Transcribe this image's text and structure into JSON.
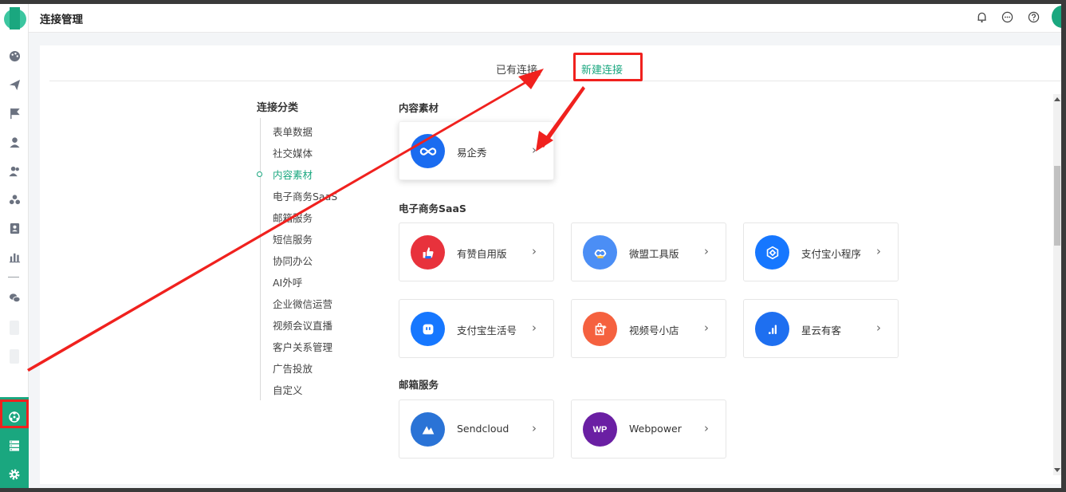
{
  "header": {
    "title": "连接管理"
  },
  "tabs": [
    {
      "label": "已有连接",
      "active": false
    },
    {
      "label": "新建连接",
      "active": true
    }
  ],
  "categories": {
    "title": "连接分类",
    "items": [
      "表单数据",
      "社交媒体",
      "内容素材",
      "电子商务SaaS",
      "邮箱服务",
      "短信服务",
      "协同办公",
      "AI外呼",
      "企业微信运营",
      "视频会议直播",
      "客户关系管理",
      "广告投放",
      "自定义"
    ],
    "active_index": 2
  },
  "sections": [
    {
      "title": "内容素材",
      "cards": [
        {
          "label": "易企秀",
          "icon": "infinity-icon",
          "color": "#1a6cf0"
        }
      ]
    },
    {
      "title": "电子商务SaaS",
      "cards": [
        {
          "label": "有赞自用版",
          "icon": "thumbs-up-icon",
          "color": "#e8323c"
        },
        {
          "label": "微盟工具版",
          "icon": "weimob-icon",
          "color": "#4b8ef5"
        },
        {
          "label": "支付宝小程序",
          "icon": "alipay-miniapp-icon",
          "color": "#1677ff"
        },
        {
          "label": "支付宝生活号",
          "icon": "chat-face-icon",
          "color": "#1677ff"
        },
        {
          "label": "视频号小店",
          "icon": "shop-bag-icon",
          "color": "#f5613f"
        },
        {
          "label": "星云有客",
          "icon": "bar-chart-icon",
          "color": "#1e6ff0"
        }
      ]
    },
    {
      "title": "邮箱服务",
      "cards": [
        {
          "label": "Sendcloud",
          "icon": "sendcloud-icon",
          "color": "#2a73d6"
        },
        {
          "label": "Webpower",
          "icon": "wp-icon",
          "color": "#6a1fa3"
        }
      ]
    }
  ],
  "wp_glyph": "WP",
  "arrow_glyph": "›",
  "colors": {
    "accent": "#1aa77f",
    "annotation": "#f0211e"
  }
}
